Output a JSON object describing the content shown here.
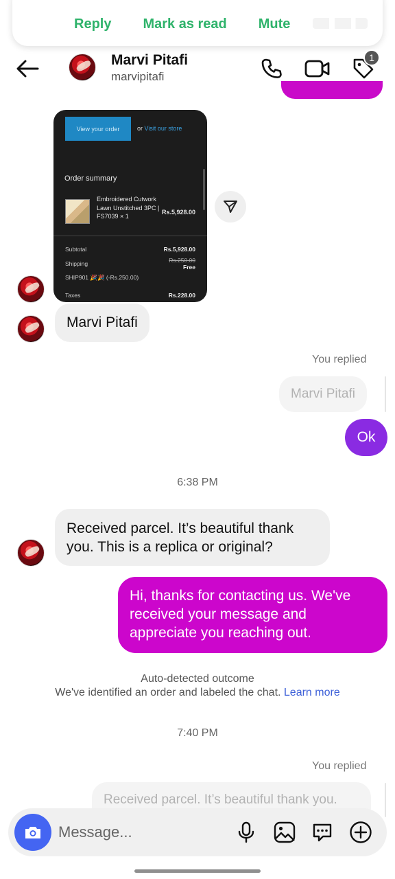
{
  "notification": {
    "actions": [
      "Reply",
      "Mark as read",
      "Mute"
    ],
    "accent": "#2fb36b"
  },
  "header": {
    "name": "Marvi Pitafi",
    "username": "marvipitafi",
    "badge_count": "1",
    "icons": [
      "back-arrow-icon",
      "phone-icon",
      "video-camera-icon",
      "tag-icon"
    ]
  },
  "shared_card": {
    "view_order_label": "View your order",
    "or_text": "or",
    "visit_store_label": "Visit our store",
    "summary_title": "Order summary",
    "product_name": "Embroidered Cutwork Lawn Unstitched 3PC | FS7039 × 1",
    "product_price": "Rs.5,928.00",
    "subtotal_label": "Subtotal",
    "subtotal_value": "Rs.5,928.00",
    "shipping_label": "Shipping",
    "shipping_old": "Rs.250.00",
    "shipping_value": "Free",
    "discount_label": "SHIP901 🎉🎉 (-Rs.250.00)",
    "taxes_label": "Taxes",
    "taxes_value": "Rs.228.00"
  },
  "messages": {
    "incoming_name": "Marvi Pitafi",
    "you_replied_1": "You replied",
    "replied_quote_1": "Marvi Pitafi",
    "outgoing_ok": "Ok",
    "time_1": "6:38 PM",
    "incoming_parcel_line1": "Received parcel. It’s beautiful thank",
    "incoming_parcel_line2": "you. This is a replica or original?",
    "outgoing_auto_line1": "Hi, thanks for contacting us. We've",
    "outgoing_auto_line2": "received your message and",
    "outgoing_auto_line3": "appreciate you reaching out.",
    "outcome_title": "Auto-detected outcome",
    "outcome_text": "We've identified an order and labeled the chat.",
    "outcome_link": "Learn more",
    "time_2": "7:40 PM",
    "you_replied_2": "You replied",
    "replied_quote_2": "Received parcel. It’s beautiful thank you."
  },
  "composer": {
    "placeholder": "Message...",
    "icons": [
      "camera-icon",
      "microphone-icon",
      "image-icon",
      "sticker-icon",
      "plus-circle-icon"
    ]
  },
  "colors": {
    "outgoing_bubble": "#cc06cc",
    "ok_bubble": "#8a2be2",
    "incoming_bubble": "#efefef",
    "camera_button": "#4465f2",
    "link": "#3c5fd8"
  }
}
